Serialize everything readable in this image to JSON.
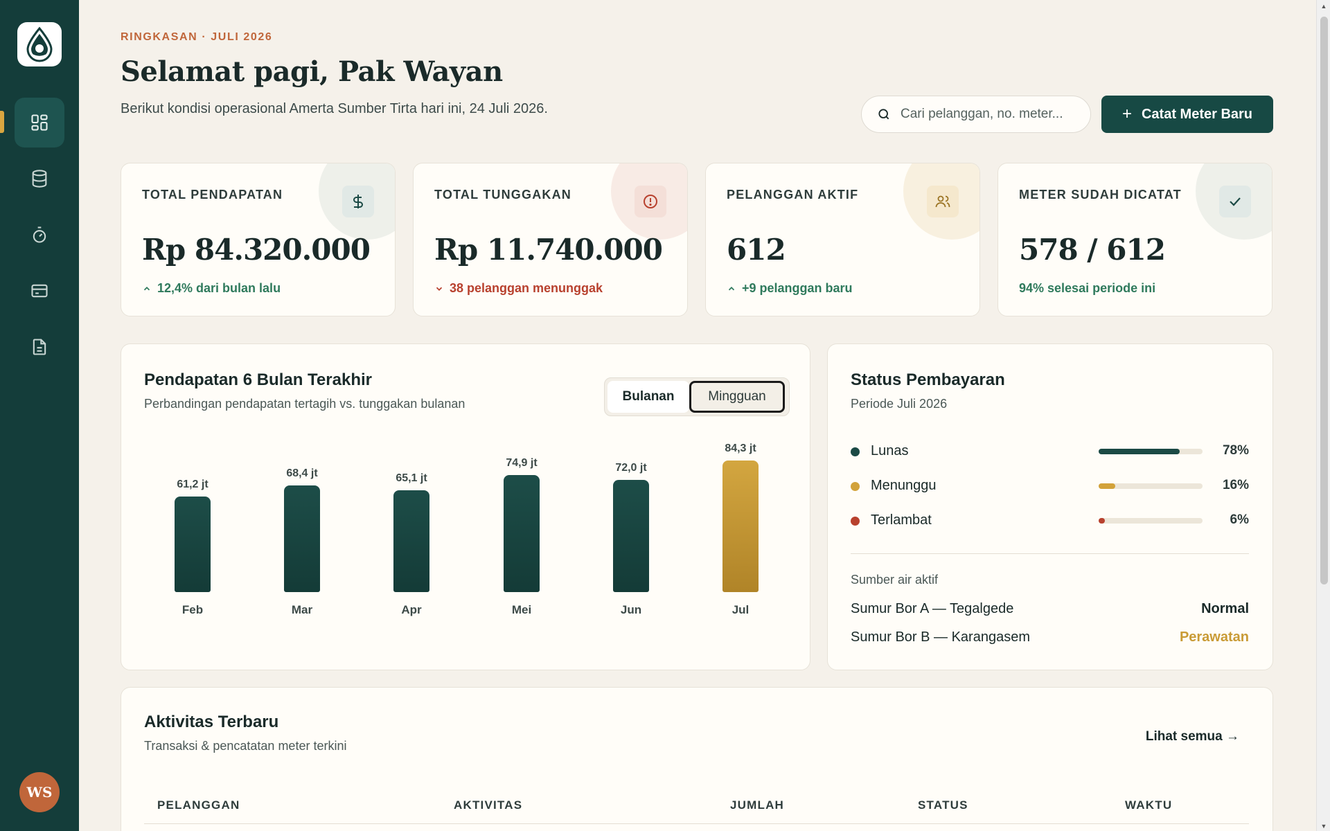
{
  "header": {
    "eyebrow": "RINGKASAN · JULI 2026",
    "title": "Selamat pagi, Pak Wayan",
    "subtitle": "Berikut kondisi operasional Amerta Sumber Tirta hari ini, 24 Juli 2026.",
    "search_placeholder": "Cari pelanggan, no. meter...",
    "primary_button": "Catat Meter Baru"
  },
  "sidebar": {
    "items": [
      {
        "icon": "dashboard-icon",
        "active": true
      },
      {
        "icon": "database-icon",
        "active": false
      },
      {
        "icon": "meter-icon",
        "active": false
      },
      {
        "icon": "card-icon",
        "active": false
      },
      {
        "icon": "document-icon",
        "active": false
      }
    ],
    "avatar_initials": "WS"
  },
  "stats": [
    {
      "label": "TOTAL PENDAPATAN",
      "value": "Rp 84.320.000",
      "note": "12,4% dari bulan lalu",
      "trend": "up",
      "icon": "dollar-icon"
    },
    {
      "label": "TOTAL TUNGGAKAN",
      "value": "Rp 11.740.000",
      "note": "38 pelanggan menunggak",
      "trend": "down",
      "icon": "alert-icon"
    },
    {
      "label": "PELANGGAN AKTIF",
      "value": "612",
      "note": "+9 pelanggan baru",
      "trend": "up",
      "icon": "users-icon"
    },
    {
      "label": "METER SUDAH DICATAT",
      "value": "578 / 612",
      "note": "94% selesai periode ini",
      "trend": "none",
      "icon": "check-icon"
    }
  ],
  "revenue_panel": {
    "title": "Pendapatan 6 Bulan Terakhir",
    "subtitle": "Perbandingan pendapatan tertagih vs. tunggakan bulanan",
    "toggle": {
      "monthly": "Bulanan",
      "weekly": "Mingguan"
    }
  },
  "chart_data": {
    "type": "bar",
    "categories": [
      "Feb",
      "Mar",
      "Apr",
      "Mei",
      "Jun",
      "Jul"
    ],
    "values": [
      61.2,
      68.4,
      65.1,
      74.9,
      72.0,
      84.3
    ],
    "value_labels": [
      "61,2 jt",
      "68,4 jt",
      "65,1 jt",
      "74,9 jt",
      "72,0 jt",
      "84,3 jt"
    ],
    "highlight_index": 5,
    "colors": {
      "default": "#1b4a45",
      "highlight": "#c99b36"
    }
  },
  "payment_status": {
    "title": "Status Pembayaran",
    "subtitle": "Periode Juli 2026",
    "items": [
      {
        "name": "Lunas",
        "pct_label": "78%",
        "pct": 78,
        "color": "#1b4a45"
      },
      {
        "name": "Menunggu",
        "pct_label": "16%",
        "pct": 16,
        "color": "#d2a23a"
      },
      {
        "name": "Terlambat",
        "pct_label": "6%",
        "pct": 6,
        "color": "#b8412e"
      }
    ],
    "sources_label": "Sumber air aktif",
    "sources": [
      {
        "name": "Sumur Bor A — Tegalgede",
        "status": "Normal",
        "color": "#1a2a29"
      },
      {
        "name": "Sumur Bor B — Karangasem",
        "status": "Perawatan",
        "color": "#c99b36"
      }
    ]
  },
  "activity": {
    "title": "Aktivitas Terbaru",
    "subtitle": "Transaksi & pencatatan meter terkini",
    "see_all": "Lihat semua →",
    "columns": [
      "PELANGGAN",
      "AKTIVITAS",
      "JUMLAH",
      "STATUS",
      "WAKTU"
    ]
  }
}
